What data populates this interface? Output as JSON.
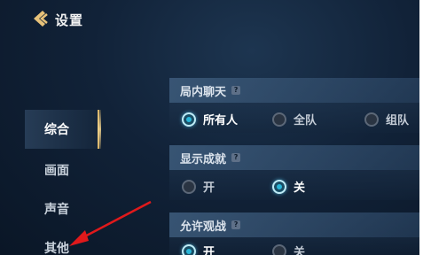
{
  "header": {
    "title": "设置"
  },
  "sidebar": {
    "items": [
      {
        "label": "综合"
      },
      {
        "label": "画面"
      },
      {
        "label": "声音"
      },
      {
        "label": "其他"
      }
    ]
  },
  "sections": {
    "chat": {
      "title": "局内聊天",
      "help_glyph": "?",
      "options": [
        {
          "label": "所有人",
          "selected": true
        },
        {
          "label": "全队",
          "selected": false
        },
        {
          "label": "组队",
          "selected": false
        }
      ]
    },
    "achievements": {
      "title": "显示成就",
      "help_glyph": "?",
      "options": [
        {
          "label": "开",
          "selected": false
        },
        {
          "label": "关",
          "selected": true
        }
      ]
    },
    "spectate": {
      "title": "允许观战",
      "help_glyph": "?",
      "options": [
        {
          "label": "开",
          "selected": true
        },
        {
          "label": "关",
          "selected": false
        }
      ]
    }
  },
  "annotation": {
    "color": "#e0191b"
  },
  "colors": {
    "accent_gold": "#d9b56a",
    "radio_on": "#29b6d8"
  }
}
